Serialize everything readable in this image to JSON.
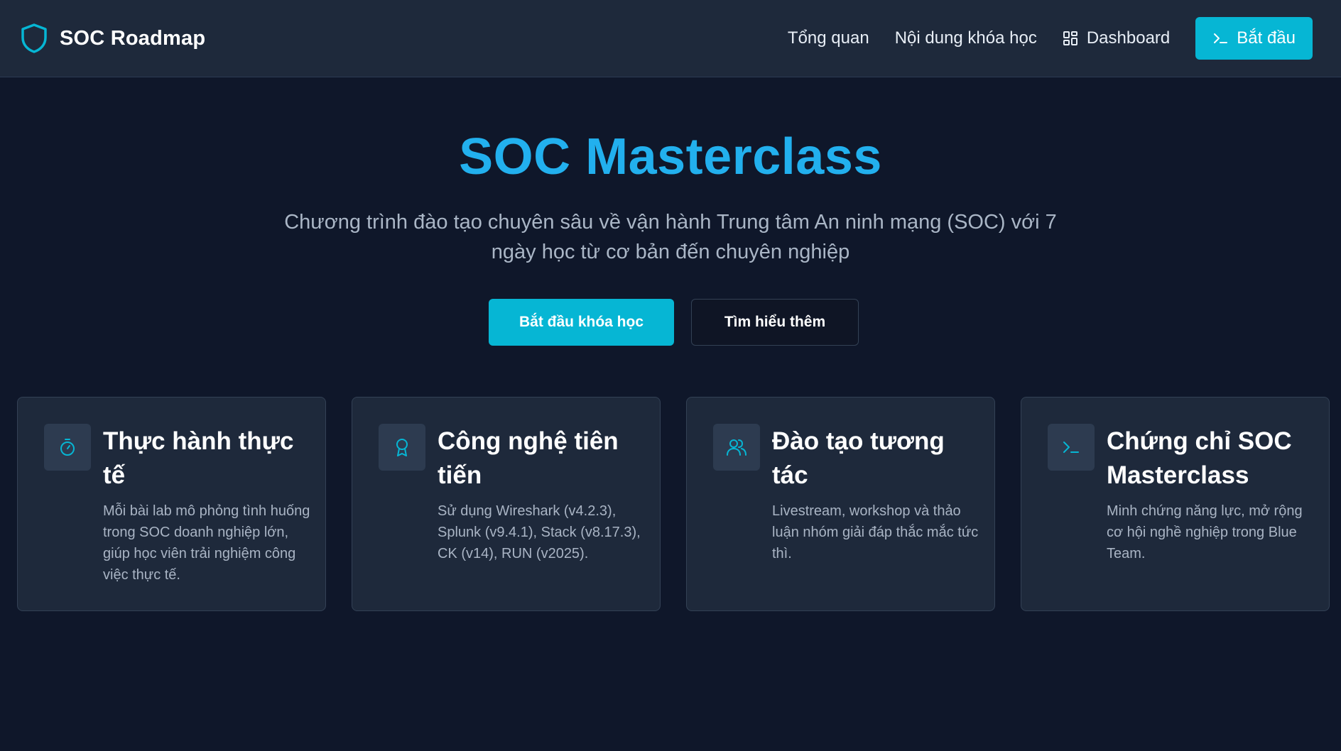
{
  "nav": {
    "brand": "SOC Roadmap",
    "links": [
      "Tổng quan",
      "Nội dung khóa học",
      "Dashboard"
    ],
    "cta": "Bắt đầu"
  },
  "hero": {
    "title": "SOC Masterclass",
    "subtitle": "Chương trình đào tạo chuyên sâu về vận hành Trung tâm An ninh mạng (SOC) với 7 ngày học từ cơ bản đến chuyên nghiệp",
    "primary_button": "Bắt đầu khóa học",
    "secondary_button": "Tìm hiểu thêm"
  },
  "features": [
    {
      "icon": "timer-icon",
      "title": "Thực hành thực tế",
      "description": "Mỗi bài lab mô phỏng tình huống trong SOC doanh nghiệp lớn, giúp học viên trải nghiệm công việc thực tế."
    },
    {
      "icon": "award-icon",
      "title": "Công nghệ tiên tiến",
      "description": "Sử dụng Wireshark (v4.2.3), Splunk (v9.4.1), Stack (v8.17.3), CK (v14), RUN (v2025)."
    },
    {
      "icon": "users-icon",
      "title": "Đào tạo tương tác",
      "description": "Livestream, workshop và thảo luận nhóm giải đáp thắc mắc tức thì."
    },
    {
      "icon": "terminal-icon",
      "title": "Chứng chỉ SOC Masterclass",
      "description": "Minh chứng năng lực, mở rộng cơ hội nghề nghiệp trong Blue Team."
    }
  ],
  "colors": {
    "background": "#0f172a",
    "surface": "#1e293b",
    "accent": "#06b6d4",
    "title": "#22b0ee"
  }
}
